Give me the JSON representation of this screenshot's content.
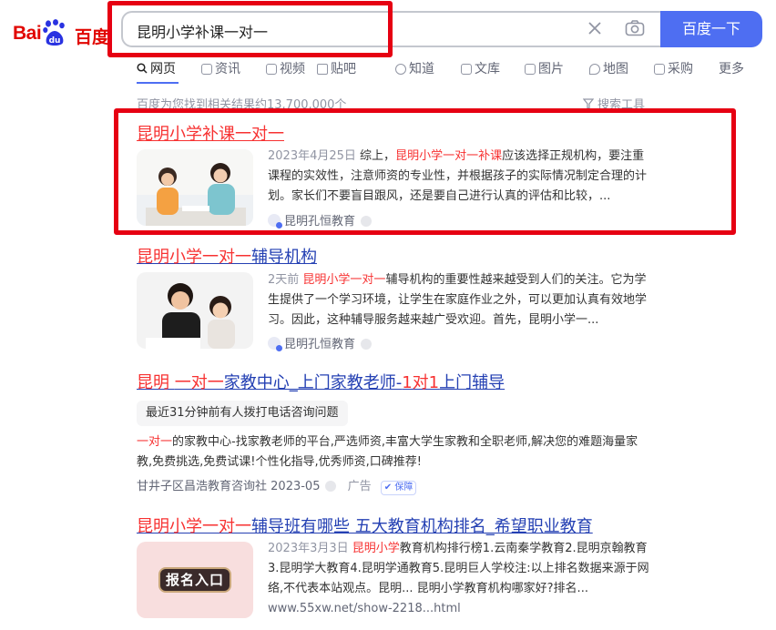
{
  "logo": {
    "bai": "Bai",
    "cn": "百度",
    "icon": "paw-logo-icon"
  },
  "search": {
    "query": "昆明小学补课一对一",
    "button": "百度一下",
    "clear_icon": "close-icon",
    "camera_icon": "camera-icon"
  },
  "tabs": [
    {
      "label": "网页",
      "icon": "search-icon"
    },
    {
      "label": "资讯",
      "icon": "news-icon"
    },
    {
      "label": "视频",
      "icon": "video-icon"
    },
    {
      "label": "贴吧",
      "icon": "tieba-icon"
    },
    {
      "label": "知道",
      "icon": "question-icon"
    },
    {
      "label": "文库",
      "icon": "doc-icon"
    },
    {
      "label": "图片",
      "icon": "image-icon"
    },
    {
      "label": "地图",
      "icon": "map-icon"
    },
    {
      "label": "采购",
      "icon": "cart-icon"
    },
    {
      "label": "更多",
      "icon": ""
    }
  ],
  "result_count": "百度为您找到相关结果约13,700,000个",
  "search_tools": "搜索工具",
  "results": [
    {
      "title": "昆明小学补课一对一",
      "date": "2023年4月25日",
      "snippet_a": "综上，",
      "snippet_em": "昆明小学一对一补课",
      "snippet_b": "应该选择正规机构，要注重课程的实效性，注意师资的专业性，并根据孩子的实际情况制定合理的计划。家长们不要盲目跟风，还是要自己进行认真的评估和比较，...",
      "source": "昆明孔恒教育"
    },
    {
      "title_em": "昆明小学一对一",
      "title_rest": "辅导机构",
      "date": "2天前",
      "snippet_em": "昆明小学一对一",
      "snippet_b": "辅导机构的重要性越来越受到人们的关注。它为学生提供了一个学习环境，让学生在家庭作业之外，可以更加认真有效地学习。因此，这种辅导服务越来越广受欢迎。首先，昆明小学一...",
      "source": "昆明孔恒教育"
    },
    {
      "title_em1": "昆明",
      "title_mid1": " ",
      "title_em2": "一对一",
      "title_mid2": "家教中心_上门家教老师-",
      "title_em3": "1对1",
      "title_rest": "上门辅导",
      "tip": "最近31分钟前有人拨打电话咨询问题",
      "snippet_em": "一对一",
      "snippet_b": "的家教中心-找家教老师的平台,严选师资,丰富大学生家教和全职老师,解决您的难题海量家教,免费挑选,免费试课!个性化指导,优秀师资,口碑推荐!",
      "source": "甘井子区昌浩教育咨询社",
      "source_date": "2023-05",
      "ad": "广告",
      "badge": "保障"
    },
    {
      "title_em": "昆明小学一对一",
      "title_rest": "辅导班有哪些 五大教育机构排名_希望职业教育",
      "date": "2023年3月3日",
      "snippet_em": "昆明小学",
      "snippet_b": "教育机构排行榜1.云南秦学教育2.昆明京翰教育3.昆明学大教育4.昆明学通教育5.昆明巨人学校注:以上排名数据来源于网络,不代表本站观点。昆明... 昆明小学教育机构哪家好?排名...",
      "source": "www.55xw.net/show-2218...html",
      "thumb_text": "报名入口"
    }
  ],
  "colors": {
    "brand_red": "#e10601",
    "link": "#2440b3",
    "highlight": "#f73131",
    "button": "#4e6ef2",
    "annotation": "#e60012"
  }
}
